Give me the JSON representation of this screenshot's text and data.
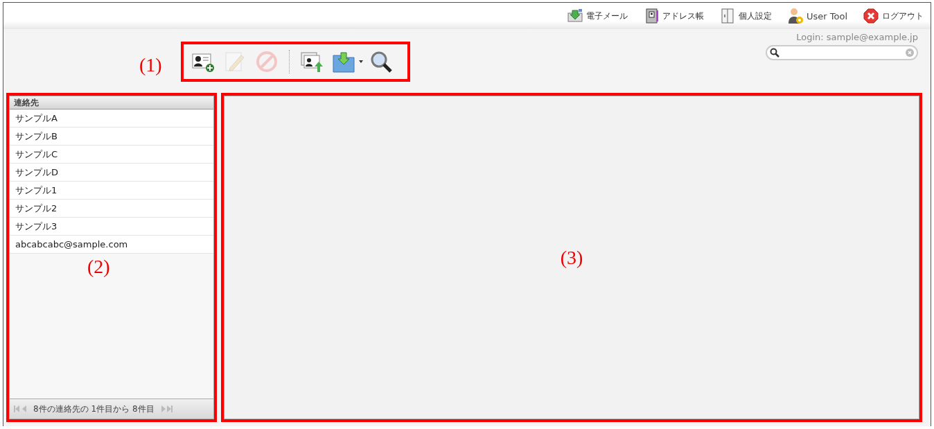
{
  "top_menu": [
    {
      "label": "電子メール"
    },
    {
      "label": "アドレス帳"
    },
    {
      "label": "個人設定"
    },
    {
      "label": "User Tool"
    },
    {
      "label": "ログアウト"
    }
  ],
  "login": "Login: sample@example.jp",
  "callouts": [
    "(1)",
    "(2)",
    "(3)"
  ],
  "toolbar": [
    {
      "kind": "button",
      "disabled": false
    },
    {
      "kind": "button",
      "disabled": true
    },
    {
      "kind": "button",
      "disabled": true
    },
    {
      "kind": "separator"
    },
    {
      "kind": "button",
      "disabled": false
    },
    {
      "kind": "dropdown",
      "disabled": false
    },
    {
      "kind": "button",
      "disabled": false
    }
  ],
  "contacts": {
    "header": "連絡先",
    "items": [
      {
        "label": "サンプルA",
        "selected": false
      },
      {
        "label": "サンプルB",
        "selected": false
      },
      {
        "label": "サンプルC",
        "selected": false
      },
      {
        "label": "サンプルD",
        "selected": false
      },
      {
        "label": "サンプル1",
        "selected": false
      },
      {
        "label": "サンプル2",
        "selected": false
      },
      {
        "label": "サンプル3",
        "selected": false
      },
      {
        "label": "abcabcabc@sample.com",
        "selected": false
      }
    ],
    "pager": "8件の連絡先の 1件目から 8件目"
  }
}
